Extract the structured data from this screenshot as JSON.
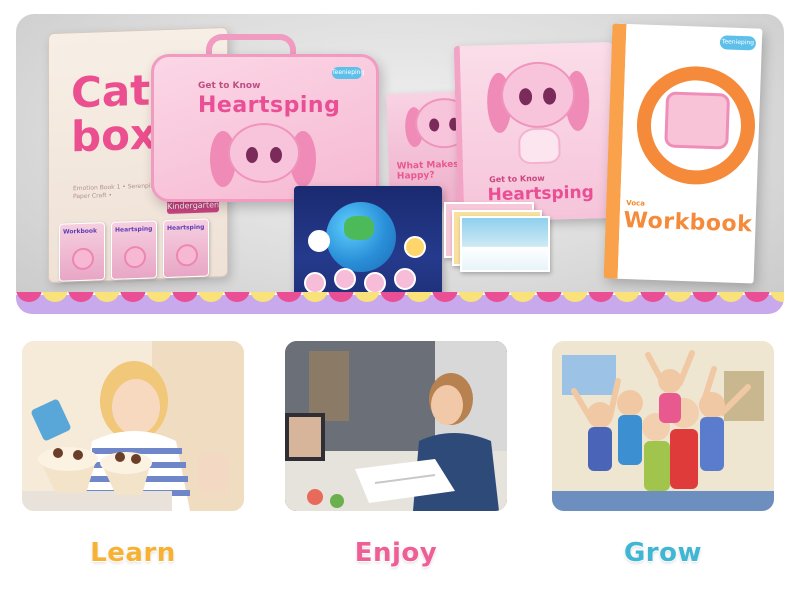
{
  "hero": {
    "catbox": {
      "title": "Cat box",
      "caption": "Emotion Book 1 • Serenping 1 • Book 1 • Paper Craft •",
      "tag": "Kindergarten"
    },
    "mini_books": [
      "Workbook",
      "Heartsping",
      "Heartsping"
    ],
    "case": {
      "subtitle": "Get to Know",
      "title": "Heartsping",
      "badge": "Teenieping"
    },
    "book_back_title": "What Makes You Happy?",
    "book_front": {
      "subtitle": "Get to Know",
      "title": "Heartsping"
    },
    "workbook": {
      "badge": "Teenieping",
      "label": "Voca",
      "title": "Workbook"
    },
    "colors": {
      "pink": "#ea4e95",
      "orange": "#f58a3a",
      "lavender": "#c8a9ec",
      "yellow": "#f9e27a"
    }
  },
  "cards": [
    {
      "label": "Learn",
      "color": "#f7b233",
      "photo": "child-baking-cupcakes-photo"
    },
    {
      "label": "Enjoy",
      "color": "#ef5f97",
      "photo": "child-online-class-photo"
    },
    {
      "label": "Grow",
      "color": "#3fb7d4",
      "photo": "children-cheering-classroom-photo"
    }
  ]
}
